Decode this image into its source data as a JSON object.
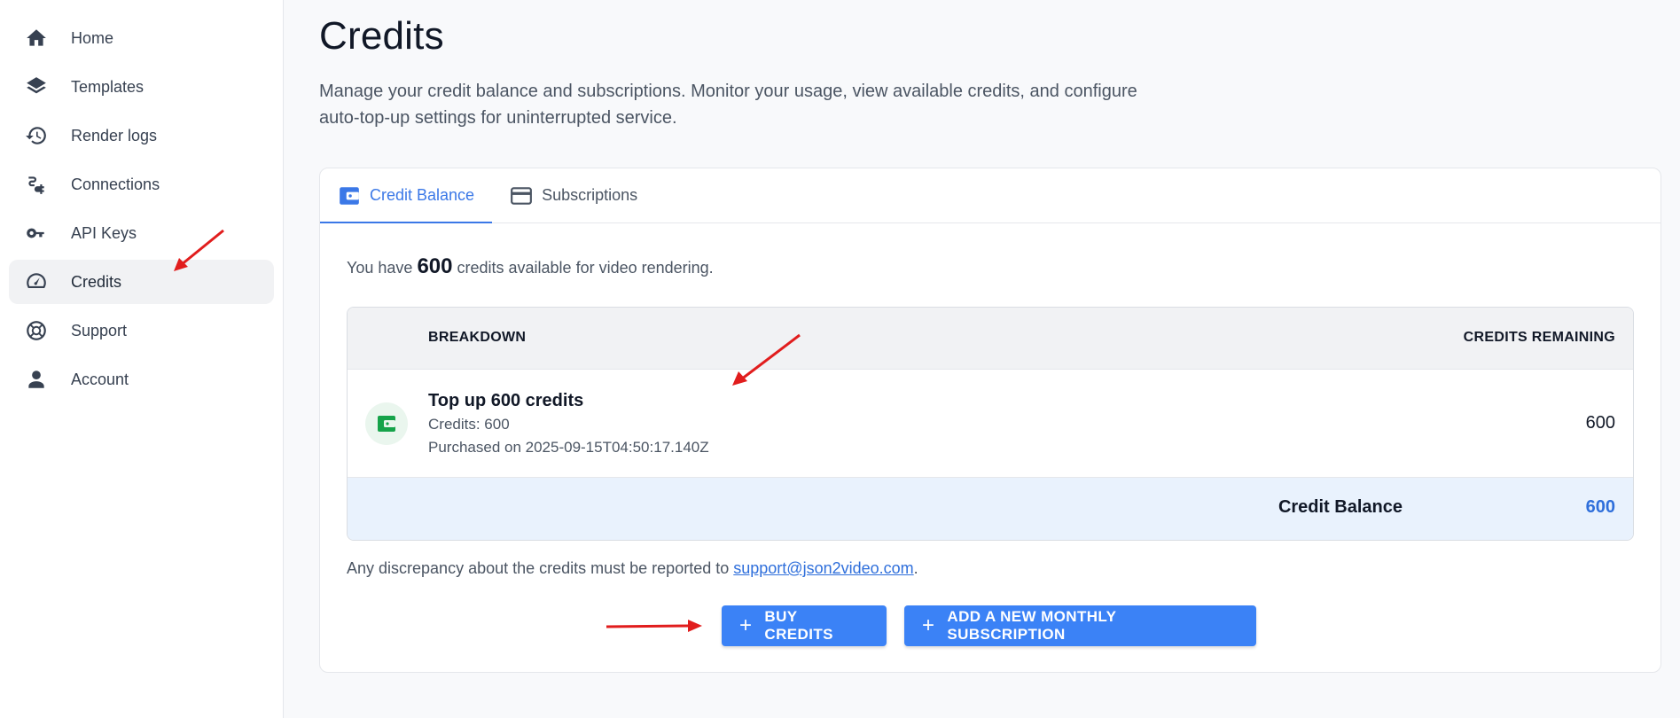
{
  "sidebar": {
    "items": [
      {
        "label": "Home",
        "icon": "home-icon"
      },
      {
        "label": "Templates",
        "icon": "layers-icon"
      },
      {
        "label": "Render logs",
        "icon": "history-icon"
      },
      {
        "label": "Connections",
        "icon": "plug-icon"
      },
      {
        "label": "API Keys",
        "icon": "key-icon"
      },
      {
        "label": "Credits",
        "icon": "gauge-icon",
        "active": true
      },
      {
        "label": "Support",
        "icon": "lifebuoy-icon"
      },
      {
        "label": "Account",
        "icon": "user-icon"
      }
    ]
  },
  "page": {
    "title": "Credits",
    "description": "Manage your credit balance and subscriptions. Monitor your usage, view available credits, and configure auto-top-up settings for uninterrupted service."
  },
  "tabs": [
    {
      "label": "Credit Balance",
      "icon": "wallet-icon",
      "active": true
    },
    {
      "label": "Subscriptions",
      "icon": "credit-card-icon",
      "active": false
    }
  ],
  "balance": {
    "prefix": "You have",
    "amount": "600",
    "suffix": "credits available for video rendering."
  },
  "table": {
    "headers": {
      "breakdown": "BREAKDOWN",
      "remaining": "CREDITS REMAINING"
    },
    "rows": [
      {
        "icon": "wallet-icon",
        "title": "Top up 600 credits",
        "credits_line": "Credits: 600",
        "purchased_line": "Purchased on 2025-09-15T04:50:17.140Z",
        "remaining": "600"
      }
    ],
    "footer": {
      "label": "Credit Balance",
      "value": "600"
    }
  },
  "discrepancy": {
    "text": "Any discrepancy about the credits must be reported to",
    "email": "support@json2video.com",
    "end": "."
  },
  "buttons": {
    "buy": "BUY CREDITS",
    "subscription": "ADD A NEW MONTHLY SUBSCRIPTION",
    "plus": "+"
  },
  "colors": {
    "accent": "#3b82f6",
    "link": "#2f6fdb",
    "success": "#16a34a",
    "annotation": "#e11d1d"
  }
}
